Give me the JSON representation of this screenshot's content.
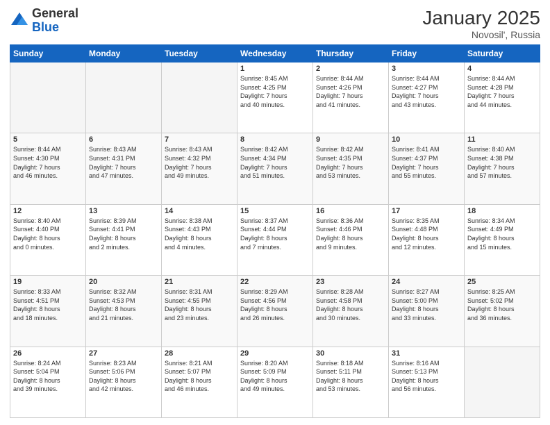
{
  "logo": {
    "general": "General",
    "blue": "Blue"
  },
  "title": "January 2025",
  "location": "Novosil', Russia",
  "days_of_week": [
    "Sunday",
    "Monday",
    "Tuesday",
    "Wednesday",
    "Thursday",
    "Friday",
    "Saturday"
  ],
  "weeks": [
    [
      {
        "day": "",
        "info": ""
      },
      {
        "day": "",
        "info": ""
      },
      {
        "day": "",
        "info": ""
      },
      {
        "day": "1",
        "info": "Sunrise: 8:45 AM\nSunset: 4:25 PM\nDaylight: 7 hours\nand 40 minutes."
      },
      {
        "day": "2",
        "info": "Sunrise: 8:44 AM\nSunset: 4:26 PM\nDaylight: 7 hours\nand 41 minutes."
      },
      {
        "day": "3",
        "info": "Sunrise: 8:44 AM\nSunset: 4:27 PM\nDaylight: 7 hours\nand 43 minutes."
      },
      {
        "day": "4",
        "info": "Sunrise: 8:44 AM\nSunset: 4:28 PM\nDaylight: 7 hours\nand 44 minutes."
      }
    ],
    [
      {
        "day": "5",
        "info": "Sunrise: 8:44 AM\nSunset: 4:30 PM\nDaylight: 7 hours\nand 46 minutes."
      },
      {
        "day": "6",
        "info": "Sunrise: 8:43 AM\nSunset: 4:31 PM\nDaylight: 7 hours\nand 47 minutes."
      },
      {
        "day": "7",
        "info": "Sunrise: 8:43 AM\nSunset: 4:32 PM\nDaylight: 7 hours\nand 49 minutes."
      },
      {
        "day": "8",
        "info": "Sunrise: 8:42 AM\nSunset: 4:34 PM\nDaylight: 7 hours\nand 51 minutes."
      },
      {
        "day": "9",
        "info": "Sunrise: 8:42 AM\nSunset: 4:35 PM\nDaylight: 7 hours\nand 53 minutes."
      },
      {
        "day": "10",
        "info": "Sunrise: 8:41 AM\nSunset: 4:37 PM\nDaylight: 7 hours\nand 55 minutes."
      },
      {
        "day": "11",
        "info": "Sunrise: 8:40 AM\nSunset: 4:38 PM\nDaylight: 7 hours\nand 57 minutes."
      }
    ],
    [
      {
        "day": "12",
        "info": "Sunrise: 8:40 AM\nSunset: 4:40 PM\nDaylight: 8 hours\nand 0 minutes."
      },
      {
        "day": "13",
        "info": "Sunrise: 8:39 AM\nSunset: 4:41 PM\nDaylight: 8 hours\nand 2 minutes."
      },
      {
        "day": "14",
        "info": "Sunrise: 8:38 AM\nSunset: 4:43 PM\nDaylight: 8 hours\nand 4 minutes."
      },
      {
        "day": "15",
        "info": "Sunrise: 8:37 AM\nSunset: 4:44 PM\nDaylight: 8 hours\nand 7 minutes."
      },
      {
        "day": "16",
        "info": "Sunrise: 8:36 AM\nSunset: 4:46 PM\nDaylight: 8 hours\nand 9 minutes."
      },
      {
        "day": "17",
        "info": "Sunrise: 8:35 AM\nSunset: 4:48 PM\nDaylight: 8 hours\nand 12 minutes."
      },
      {
        "day": "18",
        "info": "Sunrise: 8:34 AM\nSunset: 4:49 PM\nDaylight: 8 hours\nand 15 minutes."
      }
    ],
    [
      {
        "day": "19",
        "info": "Sunrise: 8:33 AM\nSunset: 4:51 PM\nDaylight: 8 hours\nand 18 minutes."
      },
      {
        "day": "20",
        "info": "Sunrise: 8:32 AM\nSunset: 4:53 PM\nDaylight: 8 hours\nand 21 minutes."
      },
      {
        "day": "21",
        "info": "Sunrise: 8:31 AM\nSunset: 4:55 PM\nDaylight: 8 hours\nand 23 minutes."
      },
      {
        "day": "22",
        "info": "Sunrise: 8:29 AM\nSunset: 4:56 PM\nDaylight: 8 hours\nand 26 minutes."
      },
      {
        "day": "23",
        "info": "Sunrise: 8:28 AM\nSunset: 4:58 PM\nDaylight: 8 hours\nand 30 minutes."
      },
      {
        "day": "24",
        "info": "Sunrise: 8:27 AM\nSunset: 5:00 PM\nDaylight: 8 hours\nand 33 minutes."
      },
      {
        "day": "25",
        "info": "Sunrise: 8:25 AM\nSunset: 5:02 PM\nDaylight: 8 hours\nand 36 minutes."
      }
    ],
    [
      {
        "day": "26",
        "info": "Sunrise: 8:24 AM\nSunset: 5:04 PM\nDaylight: 8 hours\nand 39 minutes."
      },
      {
        "day": "27",
        "info": "Sunrise: 8:23 AM\nSunset: 5:06 PM\nDaylight: 8 hours\nand 42 minutes."
      },
      {
        "day": "28",
        "info": "Sunrise: 8:21 AM\nSunset: 5:07 PM\nDaylight: 8 hours\nand 46 minutes."
      },
      {
        "day": "29",
        "info": "Sunrise: 8:20 AM\nSunset: 5:09 PM\nDaylight: 8 hours\nand 49 minutes."
      },
      {
        "day": "30",
        "info": "Sunrise: 8:18 AM\nSunset: 5:11 PM\nDaylight: 8 hours\nand 53 minutes."
      },
      {
        "day": "31",
        "info": "Sunrise: 8:16 AM\nSunset: 5:13 PM\nDaylight: 8 hours\nand 56 minutes."
      },
      {
        "day": "",
        "info": ""
      }
    ]
  ]
}
